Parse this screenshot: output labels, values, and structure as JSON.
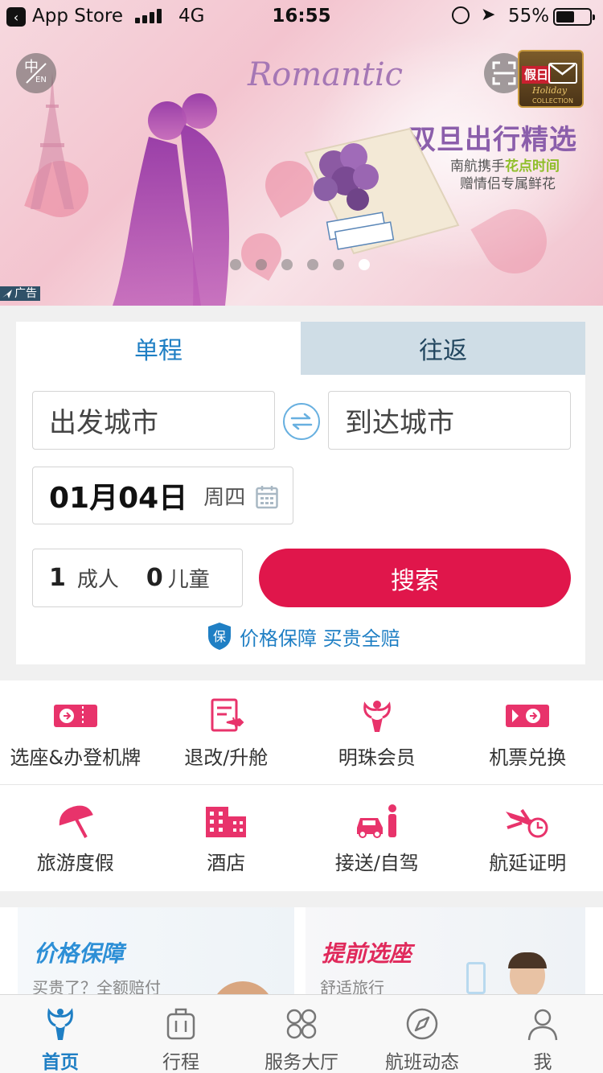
{
  "status_bar": {
    "back_app": "App Store",
    "network": "4G",
    "time": "16:55",
    "battery_percent": "55%",
    "battery_level": 0.55
  },
  "banner": {
    "lang_zh": "中",
    "lang_en": "EN",
    "script_text": "Romantic",
    "title": "双旦出行精选",
    "subtitle_prefix": "南航携手",
    "subtitle_highlight": "花点时间",
    "subtitle_line2": "赠情侣专属鲜花",
    "badge_text": "假日",
    "badge_script": "Holiday",
    "badge_collection": "COLLECTION",
    "ad_label": "广告",
    "slide_count": 6,
    "active_slide": 5
  },
  "booking": {
    "tabs": [
      {
        "label": "单程",
        "active": true
      },
      {
        "label": "往返",
        "active": false
      }
    ],
    "from_placeholder": "出发城市",
    "to_placeholder": "到达城市",
    "date": "01月04日",
    "weekday": "周四",
    "adults": "1",
    "adults_label": "成人",
    "children": "0",
    "children_label": "儿童",
    "search_label": "搜索",
    "guarantee_badge": "保",
    "guarantee_text": "价格保障 买贵全赔"
  },
  "services": [
    {
      "label": "选座&办登机牌",
      "icon": "boarding-pass-icon"
    },
    {
      "label": "退改/升舱",
      "icon": "ticket-change-icon"
    },
    {
      "label": "明珠会员",
      "icon": "pearl-member-icon"
    },
    {
      "label": "机票兑换",
      "icon": "ticket-exchange-icon"
    },
    {
      "label": "旅游度假",
      "icon": "beach-umbrella-icon"
    },
    {
      "label": "酒店",
      "icon": "hotel-icon"
    },
    {
      "label": "接送/自驾",
      "icon": "car-transfer-icon"
    },
    {
      "label": "航延证明",
      "icon": "flight-delay-icon"
    }
  ],
  "promos": [
    {
      "title": "价格保障",
      "subtitle": "买贵了？全额赔付"
    },
    {
      "title": "提前选座",
      "subtitle": "舒适旅行"
    }
  ],
  "tabbar": [
    {
      "label": "首页",
      "icon": "home-icon",
      "active": true
    },
    {
      "label": "行程",
      "icon": "luggage-icon",
      "active": false
    },
    {
      "label": "服务大厅",
      "icon": "service-grid-icon",
      "active": false
    },
    {
      "label": "航班动态",
      "icon": "compass-icon",
      "active": false
    },
    {
      "label": "我",
      "icon": "profile-icon",
      "active": false
    }
  ],
  "colors": {
    "primary_blue": "#1f7fc4",
    "search_red": "#e0164b",
    "icon_pink": "#e8336b",
    "tab_inactive_bg": "#cfdde6"
  }
}
